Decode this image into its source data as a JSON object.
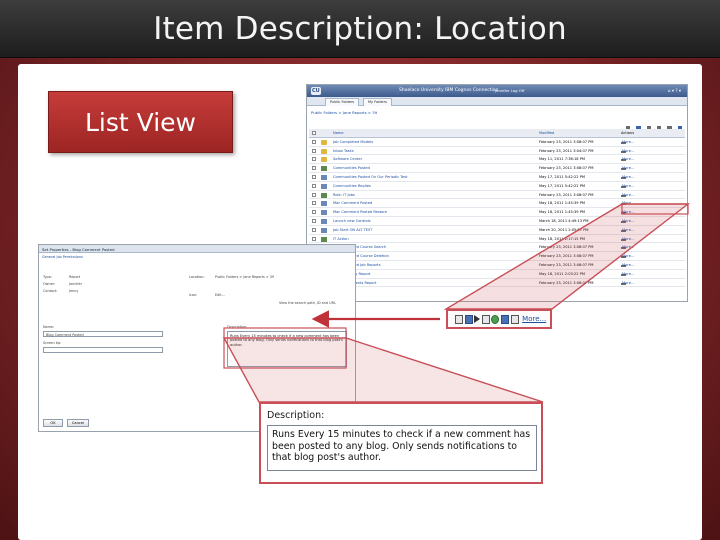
{
  "slide": {
    "title": "Item Description: Location",
    "label": "List View"
  },
  "colors": {
    "title_bar": "#2a2a2a",
    "background": "#7a2426",
    "label_box": "#b52f2d",
    "callout_border": "#c84f57",
    "link": "#1c4fa0"
  },
  "list_view": {
    "header_app": "Shoelace University IBM Cognos Connection",
    "header_right": "Jennifer Log Off",
    "tabs": [
      "Public Folders",
      "My Folders"
    ],
    "breadcrumb": "Public Folders > Jane Reports > 39",
    "columns": {
      "name": "Name",
      "modified": "Modified",
      "actions": "Actions"
    },
    "rows": [
      {
        "icon": "folder",
        "name": "Job Completed Models",
        "modified": "February 23, 2011 3:08:07 PM",
        "more": "More..."
      },
      {
        "icon": "folder",
        "name": "Inbox Tasks",
        "modified": "February 23, 2011 3:04:07 PM",
        "more": "More..."
      },
      {
        "icon": "folder",
        "name": "Software Center",
        "modified": "May 11, 2011 7:36:18 PM",
        "more": "More..."
      },
      {
        "icon": "job",
        "name": "Communities Posted",
        "modified": "February 23, 2011 3:08:07 PM",
        "more": "More..."
      },
      {
        "icon": "report",
        "name": "Communities Posted On Our Periodic Test",
        "modified": "May 17, 2011 5:42:22 PM",
        "more": "More..."
      },
      {
        "icon": "report",
        "name": "Communities Replies",
        "modified": "May 17, 2011 5:42:22 PM",
        "more": "More..."
      },
      {
        "icon": "job",
        "name": "Role: IT Jobs",
        "modified": "February 23, 2011 3:08:07 PM",
        "more": "More..."
      },
      {
        "icon": "report",
        "name": "Mac Comment Posted",
        "modified": "May 18, 2011 1:45:39 PM",
        "more": "More..."
      },
      {
        "icon": "report",
        "name": "Mac Comment Posted Restore",
        "modified": "May 18, 2011 1:45:39 PM",
        "more": "More..."
      },
      {
        "icon": "report",
        "name": "Launch new Controls",
        "modified": "March 18, 2011 4:49:13 PM",
        "more": "More..."
      },
      {
        "icon": "report",
        "name": "Job Start ON ALT TEST",
        "modified": "March 20, 2011 2:05:57 PM",
        "more": "More..."
      },
      {
        "icon": "job",
        "name": "IT Action",
        "modified": "May 18, 2011 2:17:15 PM",
        "more": "More..."
      },
      {
        "icon": "report",
        "name": "My Completed Course Search",
        "modified": "February 23, 2011 3:08:07 PM",
        "more": "More..."
      },
      {
        "icon": "report",
        "name": "My Completed Course Deletion",
        "modified": "February 23, 2011 3:08:07 PM",
        "more": "More..."
      },
      {
        "icon": "report",
        "name": "My Completed Job Reports",
        "modified": "February 23, 2011 3:08:07 PM",
        "more": "More..."
      },
      {
        "icon": "report",
        "name": "Search Query Report",
        "modified": "May 18, 2011 2:03:22 PM",
        "more": "More..."
      },
      {
        "icon": "report",
        "name": "Block Comments Report",
        "modified": "February 23, 2011 3:08:07 PM",
        "more": "More..."
      }
    ]
  },
  "properties": {
    "title": "Set Properties - Blog Comment Posted",
    "tabs": "General  Job  Permissions",
    "fields": {
      "type_label": "Type:",
      "type_value": "Report",
      "owner_label": "Owner:",
      "owner_value": "Jennifer",
      "contact_label": "Contact:",
      "contact_value": "Jenny",
      "location_label": "Location:",
      "location_value": "Public Folders > Jane Reports > 39",
      "name_label": "Name:",
      "name_value": "Blog Comment Posted",
      "screen_tip_label": "Screen tip:",
      "description_label": "Description:",
      "description_value": "Runs Every 15 minutes to check if a new comment has been posted to any blog. Only sends notifications to that blog post's author.",
      "view_link": "View the search path, ID and URL",
      "icon_label": "Icon:",
      "icon_value": "Edit...",
      "ok_label": "OK",
      "cancel_label": "Cancel"
    }
  },
  "zoom_actions": {
    "more_label": "More..."
  },
  "zoom_description": {
    "label": "Description:",
    "text": "Runs Every 15 minutes to check if a new comment has been posted to any blog. Only sends notifications to that blog post's author."
  }
}
